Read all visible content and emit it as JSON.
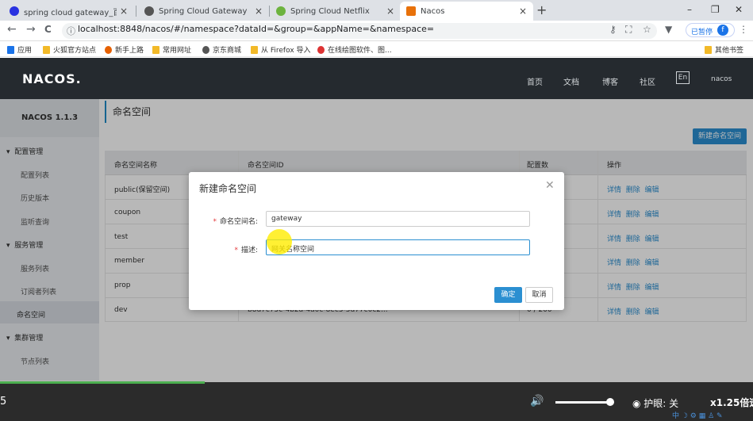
{
  "browser": {
    "tabs": [
      {
        "title": "spring cloud gateway_百度搜索",
        "color": "#2932e1"
      },
      {
        "title": "Spring Cloud Gateway",
        "color": "#555555"
      },
      {
        "title": "Spring Cloud Netflix",
        "color": "#6db33f"
      },
      {
        "title": "Nacos",
        "color": "#e8710a"
      }
    ],
    "new_tab": "+",
    "close": "×",
    "win": {
      "min": "–",
      "max": "❐",
      "close": "✕"
    },
    "nav": {
      "back": "←",
      "forward": "→",
      "reload": "C"
    },
    "url": "localhost:8848/nacos/#/namespace?dataId=&group=&appName=&namespace=",
    "paused": "已暂停",
    "avatar": "f",
    "bookmarks": [
      "应用",
      "火狐官方站点",
      "新手上路",
      "常用网址",
      "京东商城",
      "从 Firefox 导入",
      "在线绘图软件、图..."
    ],
    "other_bookmarks": "其他书签"
  },
  "nacos": {
    "logo": "NACOS.",
    "nav": [
      "首页",
      "文档",
      "博客",
      "社区"
    ],
    "lang": "En",
    "user": "nacos",
    "version": "NACOS 1.1.3",
    "sidebar": {
      "g1": "配置管理",
      "g1_items": [
        "配置列表",
        "历史版本",
        "监听查询"
      ],
      "g2": "服务管理",
      "g2_items": [
        "服务列表",
        "订阅者列表"
      ],
      "ns": "命名空间",
      "g3": "集群管理",
      "g3_items": [
        "节点列表"
      ]
    },
    "page_title": "命名空间",
    "new_button": "新建命名空间",
    "table": {
      "headers": [
        "命名空间名称",
        "命名空间ID",
        "配置数",
        "操作"
      ],
      "rows": [
        "public(保留空间)",
        "coupon",
        "test",
        "member",
        "prop",
        "dev"
      ],
      "dev_id": "b8d7c75c-4b2a-4a0c-8ec3-5d77c0c2...",
      "dev_count": "0 / 200",
      "ops": [
        "详情",
        "删除",
        "编辑"
      ]
    }
  },
  "dialog": {
    "title": "新建命名空间",
    "name_label": "命名空间名:",
    "name_value": "gateway",
    "desc_label": "描述:",
    "desc_value": "网关名称空间",
    "ok": "确定",
    "cancel": "取消",
    "required": "*"
  },
  "player": {
    "time": "5",
    "eye": "护眼: 关",
    "speed": "x1.25倍速",
    "tray": "中 ☽ ⚙ ▦ ♙ ✎"
  }
}
